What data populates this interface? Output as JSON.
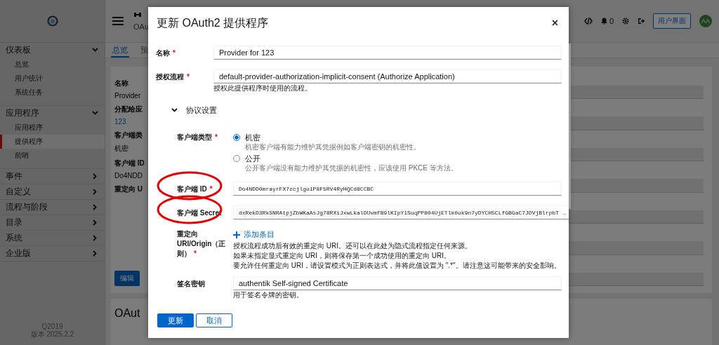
{
  "sidebar": {
    "groups": [
      {
        "label": "仪表板",
        "expanded": true,
        "items": [
          {
            "label": "总览",
            "selected": false
          },
          {
            "label": "用户统计",
            "selected": false
          },
          {
            "label": "系统任务",
            "selected": false
          }
        ]
      },
      {
        "label": "应用程序",
        "expanded": true,
        "items": [
          {
            "label": "应用程序",
            "selected": false
          },
          {
            "label": "提供程序",
            "selected": true
          },
          {
            "label": "前哨",
            "selected": false
          }
        ]
      },
      {
        "label": "事件",
        "expanded": false
      },
      {
        "label": "自定义",
        "expanded": false
      },
      {
        "label": "流程与阶段",
        "expanded": false
      },
      {
        "label": "目录",
        "expanded": false
      },
      {
        "label": "系统",
        "expanded": false
      },
      {
        "label": "企业版",
        "expanded": false
      }
    ],
    "footer": [
      "Q2019",
      "版本 2025.2.2"
    ]
  },
  "header": {
    "title": "OAu",
    "notification_count": "0",
    "user_interface_button": "用户界面",
    "avatar": "AA"
  },
  "tabs": [
    {
      "label": "总览",
      "selected": true
    },
    {
      "label": "预",
      "selected": false
    }
  ],
  "details": [
    {
      "label": "名称",
      "value": "Provider",
      "kind": "text"
    },
    {
      "label": "分配给应",
      "value": "123",
      "kind": "link"
    },
    {
      "label": "客户端类",
      "value": "机密",
      "kind": "text"
    },
    {
      "label": "客户端 ID",
      "value": "Do4NDD",
      "kind": "text"
    },
    {
      "label": "重定向 U",
      "kind": "empty"
    }
  ],
  "edit_button": "编辑",
  "section_heading": "OAut",
  "dialog": {
    "title": "更新 OAuth2 提供程序",
    "close": "×",
    "required_mark": "*",
    "fields": [
      {
        "kind": "text",
        "label": "名称",
        "required": true,
        "value": "Provider for 123"
      },
      {
        "kind": "text",
        "label": "授权流程",
        "required": true,
        "value": "default-provider-authorization-implicit-consent (Authorize Application)",
        "help": [
          "授权此提供程序时使用的流程。"
        ]
      }
    ],
    "protocol_section": {
      "label": "协议设置",
      "expanded": true,
      "fields": [
        {
          "kind": "radio",
          "label": "客户端类型",
          "required": true,
          "options": [
            {
              "label": "机密",
              "selected": true,
              "help": "机密客户端有能力维护其凭据例如客户端密钥的机密性。"
            },
            {
              "label": "公开",
              "selected": false,
              "help": "公开客户端没有能力维护其凭据的机密性，应该使用 PKCE 等方法。"
            }
          ]
        },
        {
          "kind": "mono",
          "label": "客户端 ID",
          "required": true,
          "circled": true,
          "value": "Do4NDD0mrayrFX7zcjlgu1P8F5RV4RyHQCd8CCBC"
        },
        {
          "kind": "mono",
          "label": "客户端 Secret",
          "required": false,
          "circled": true,
          "value": "dxRekD3RkSNRAtpjZbWKaAsJg78RXiJxwLkalDUvmfB9lKIpY1SuqPP804UjETlk0uk9n7yDYCH5CLfGBGaC7JDVjBlrpbT …"
        },
        {
          "kind": "list",
          "label": "重定向 URI/Origin（正则）",
          "required": true,
          "add_label": "添加条目",
          "help": [
            "授权流程成功后有效的重定向 URI。还可以在此处为隐式流程指定任何来源。",
            "如果未指定显式重定向 URI，则将保存第一个成功使用的重定向 URI。",
            "要允许任何重定向 URI，请设置模式为正则表达式，并将此值设置为 \".*\"。请注意这可能带来的安全影响。"
          ]
        },
        {
          "kind": "text",
          "label": "签名密钥",
          "required": false,
          "value": "authentik Self-signed Certificate",
          "help": [
            "用于签名令牌的密钥。"
          ]
        }
      ]
    },
    "buttons": [
      {
        "label": "更新",
        "kind": "primary"
      },
      {
        "label": "取消",
        "kind": "secondary"
      }
    ]
  }
}
